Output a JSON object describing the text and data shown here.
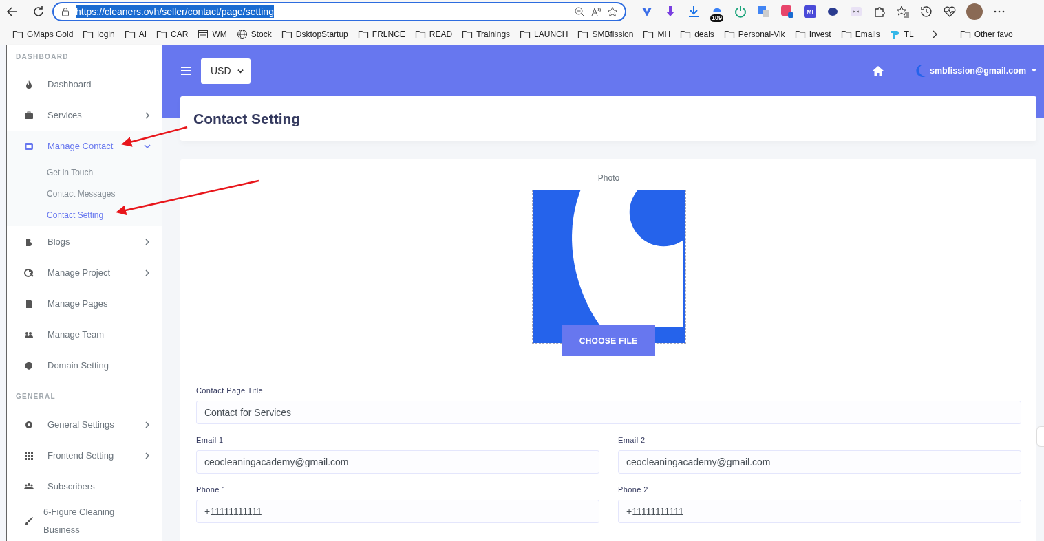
{
  "browser": {
    "url": "https://cleaners.ovh/seller/contact/page/setting",
    "url_selected": true,
    "badge": "109",
    "ext_label": "MI",
    "bookmarks": [
      {
        "label": "GMaps Gold",
        "kind": "folder"
      },
      {
        "label": "login",
        "kind": "folder"
      },
      {
        "label": "AI",
        "kind": "folder"
      },
      {
        "label": "CAR",
        "kind": "folder"
      },
      {
        "label": "WM",
        "kind": "page"
      },
      {
        "label": "Stock",
        "kind": "globe"
      },
      {
        "label": "DsktopStartup",
        "kind": "folder"
      },
      {
        "label": "FRLNCE",
        "kind": "folder"
      },
      {
        "label": "READ",
        "kind": "folder"
      },
      {
        "label": "Trainings",
        "kind": "folder"
      },
      {
        "label": "LAUNCH",
        "kind": "folder"
      },
      {
        "label": "SMBfission",
        "kind": "folder"
      },
      {
        "label": "MH",
        "kind": "folder"
      },
      {
        "label": "deals",
        "kind": "folder"
      },
      {
        "label": "Personal-Vik",
        "kind": "folder"
      },
      {
        "label": "Invest",
        "kind": "folder"
      },
      {
        "label": "Emails",
        "kind": "folder"
      },
      {
        "label": "TL",
        "kind": "app"
      }
    ],
    "other_bookmarks": "Other favo"
  },
  "sidebar": {
    "sections": [
      {
        "heading": "DASHBOARD",
        "items": [
          {
            "label": "Dashboard",
            "has_submenu": false,
            "selected": false
          },
          {
            "label": "Services",
            "has_submenu": true,
            "selected": false,
            "expanded": false
          },
          {
            "label": "Manage Contact",
            "has_submenu": true,
            "selected": true,
            "expanded": true,
            "children": [
              {
                "label": "Get in Touch",
                "selected": false
              },
              {
                "label": "Contact Messages",
                "selected": false
              },
              {
                "label": "Contact Setting",
                "selected": true
              }
            ]
          },
          {
            "label": "Blogs",
            "has_submenu": true,
            "selected": false,
            "expanded": false
          },
          {
            "label": "Manage Project",
            "has_submenu": true,
            "selected": false,
            "expanded": false
          },
          {
            "label": "Manage Pages",
            "has_submenu": false,
            "selected": false
          },
          {
            "label": "Manage Team",
            "has_submenu": false,
            "selected": false
          },
          {
            "label": "Domain Setting",
            "has_submenu": false,
            "selected": false
          }
        ]
      },
      {
        "heading": "GENERAL",
        "items": [
          {
            "label": "General Settings",
            "has_submenu": true,
            "selected": false,
            "expanded": false
          },
          {
            "label": "Frontend Setting",
            "has_submenu": true,
            "selected": false,
            "expanded": false
          },
          {
            "label": "Subscribers",
            "has_submenu": false,
            "selected": false
          },
          {
            "label": "6-Figure Cleaning Business",
            "has_submenu": false,
            "selected": false
          }
        ]
      }
    ]
  },
  "header": {
    "currency": "USD",
    "user": "smbfission@gmail.com"
  },
  "page_title": "Contact Setting",
  "form": {
    "photo_label": "Photo",
    "choose_button": "CHOOSE FILE",
    "fields": [
      {
        "label": "Contact Page Title",
        "value": "Contact for Services",
        "kind": "wide"
      },
      {
        "label": "Email 1",
        "value": "ceocleaningacademy@gmail.com",
        "kind": "half"
      },
      {
        "label": "Email 2",
        "value": "ceocleaningacademy@gmail.com",
        "kind": "half"
      },
      {
        "label": "Phone 1",
        "value": "+11111111111",
        "kind": "half"
      },
      {
        "label": "Phone 2",
        "value": "+11111111111",
        "kind": "half"
      }
    ]
  }
}
